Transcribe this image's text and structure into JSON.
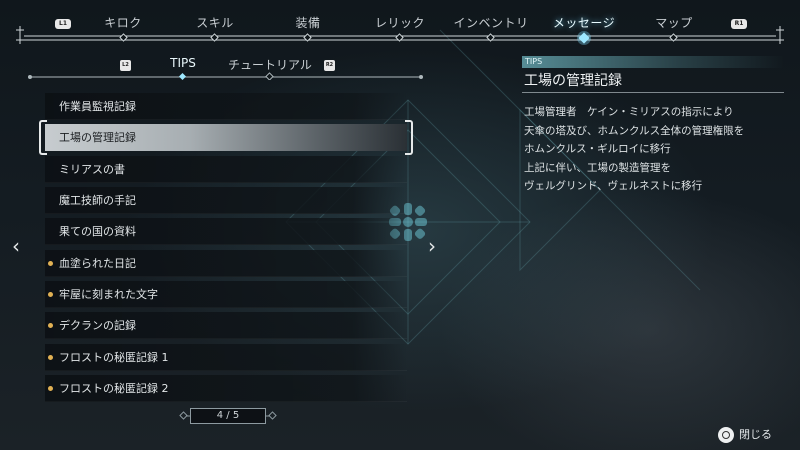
{
  "nav": {
    "left_button": "L1",
    "right_button": "R1",
    "tabs": [
      {
        "label": "キロク"
      },
      {
        "label": "スキル"
      },
      {
        "label": "装備"
      },
      {
        "label": "レリック"
      },
      {
        "label": "インベントリ"
      },
      {
        "label": "メッセージ",
        "active": true
      },
      {
        "label": "マップ"
      }
    ]
  },
  "subtabs": {
    "left_button": "L2",
    "right_button": "R2",
    "items": [
      {
        "label": "TIPS",
        "active": true
      },
      {
        "label": "チュートリアル"
      }
    ]
  },
  "list": {
    "items": [
      {
        "label": "作業員監視記録"
      },
      {
        "label": "工場の管理記録",
        "selected": true
      },
      {
        "label": "ミリアスの書"
      },
      {
        "label": "魔工技師の手記"
      },
      {
        "label": "果ての国の資料"
      },
      {
        "label": "血塗られた日記",
        "new": true
      },
      {
        "label": "牢屋に刻まれた文字",
        "new": true
      },
      {
        "label": "デクランの記録",
        "new": true
      },
      {
        "label": "フロストの秘匿記録 1",
        "new": true
      },
      {
        "label": "フロストの秘匿記録 2",
        "new": true
      }
    ],
    "prev_arrow": "‹",
    "next_arrow": "›"
  },
  "pager": {
    "text": "4 / 5"
  },
  "detail": {
    "tag": "TIPS",
    "title": "工場の管理記録",
    "lines": [
      "工場管理者　ケイン・ミリアスの指示により",
      "天傘の塔及び、ホムンクルス全体の管理権限を",
      "ホムンクルス・ギルロイに移行",
      "上記に伴い、工場の製造管理を",
      "ヴェルグリンド、ヴェルネストに移行"
    ]
  },
  "close": {
    "label": "閉じる"
  },
  "colors": {
    "accent_glow": "#7fdcff",
    "new_dot": "#e1b154",
    "selected_row": "#c7cccf"
  }
}
